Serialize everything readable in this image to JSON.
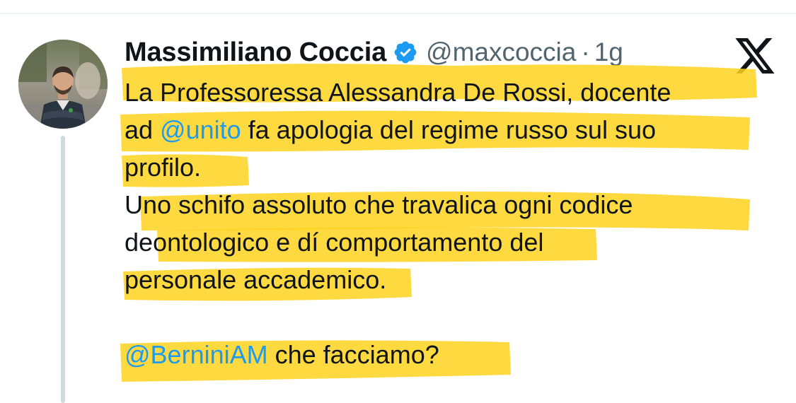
{
  "tweet": {
    "author_name": "Massimiliano Coccia",
    "handle": "@maxcoccia",
    "separator": "·",
    "timestamp": "1g",
    "verified": true,
    "body": {
      "line1": "La Professoressa Alessandra De Rossi, docente",
      "line2_prefix": "ad ",
      "line2_mention": "@unito",
      "line2_suffix": " fa apologia del regime russo sul suo",
      "line3": "profilo.",
      "line4": "Uno schifo assoluto che travalica ogni codice",
      "line5": "deontologico e dí comportamento del",
      "line6": "personale accademico.",
      "line8_mention": "@BerniniAM",
      "line8_suffix": " che facciamo?"
    }
  },
  "colors": {
    "text": "#0f1419",
    "secondary_text": "#536471",
    "link": "#1d9bf0",
    "verified_badge": "#1d9bf0",
    "highlighter": "#ffd21f",
    "thread_line": "#cfd9de",
    "divider": "#eff3f4"
  },
  "icons": {
    "verified": "verified-badge-icon",
    "logo": "x-logo-icon"
  }
}
